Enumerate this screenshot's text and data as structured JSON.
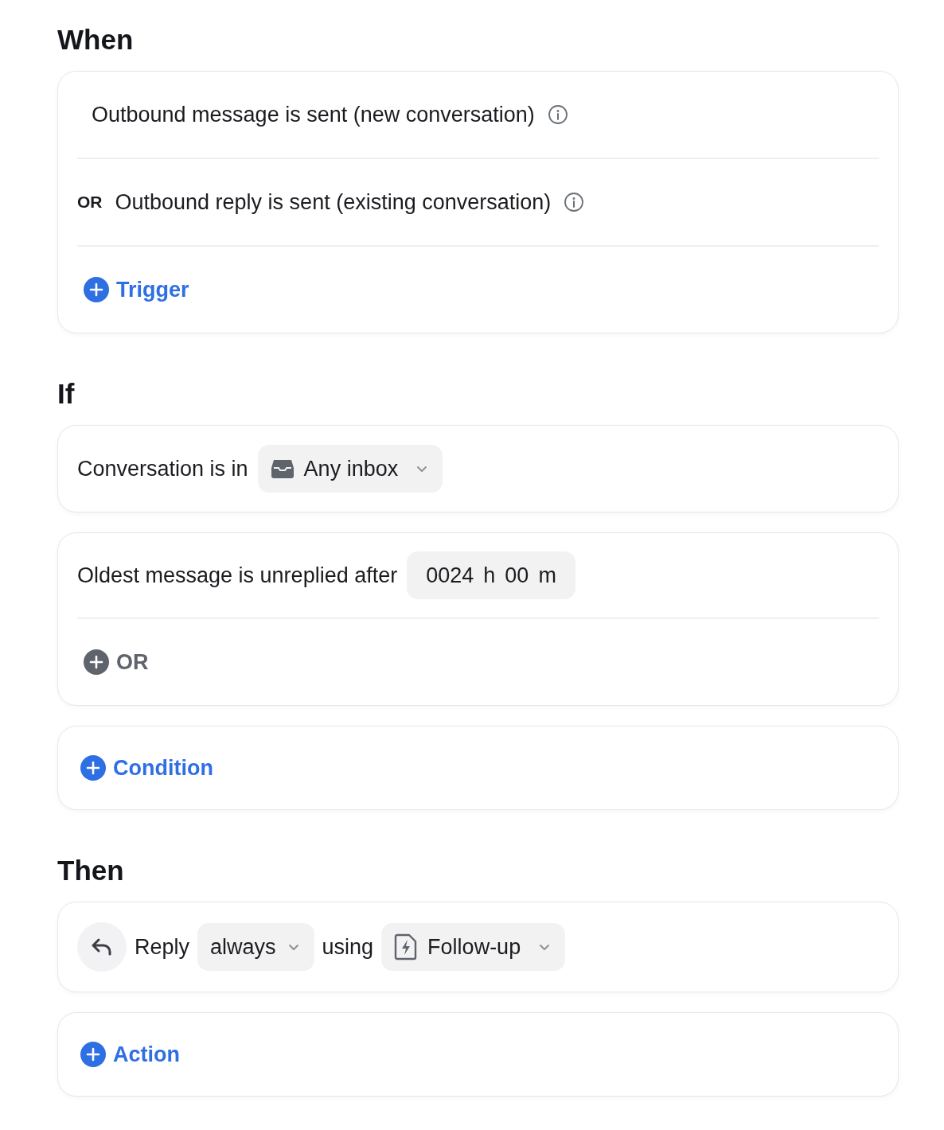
{
  "when": {
    "heading": "When",
    "triggers": [
      {
        "text": "Outbound message is sent (new conversation)"
      },
      {
        "prefix": "OR",
        "text": "Outbound reply is sent (existing conversation)"
      }
    ],
    "add": {
      "label": "Trigger",
      "kind": "primary"
    }
  },
  "if": {
    "heading": "If",
    "groups": [
      {
        "label": "Conversation is in",
        "control": {
          "kind": "select",
          "value": "Any inbox"
        }
      },
      {
        "label": "Oldest message is unreplied after",
        "control": {
          "kind": "duration",
          "hours": "0024",
          "hours_unit": "h",
          "minutes": "00",
          "minutes_unit": "m"
        },
        "add": {
          "label": "OR",
          "kind": "secondary"
        }
      }
    ],
    "add": {
      "label": "Condition",
      "kind": "primary"
    }
  },
  "then": {
    "heading": "Then",
    "action": {
      "verb": "Reply",
      "mode": "always",
      "connector": "using",
      "template": "Follow-up"
    },
    "add": {
      "label": "Action",
      "kind": "primary"
    }
  }
}
